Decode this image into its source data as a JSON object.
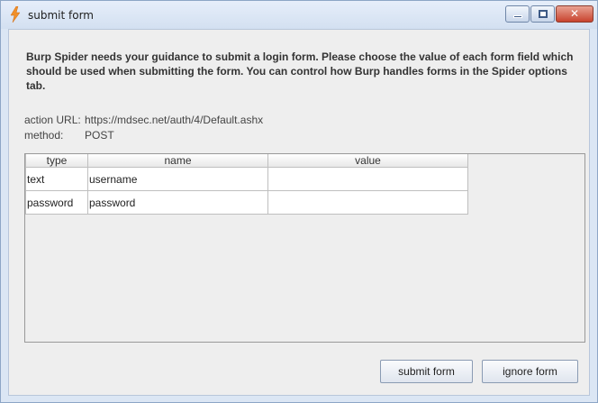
{
  "window": {
    "title": "submit form",
    "close_glyph": "✕"
  },
  "instructions": "Burp Spider needs your guidance to submit a login form. Please choose the value of each form field which should be used when submitting the form. You can control how Burp handles forms in the Spider options tab.",
  "form_info": {
    "action_label": "action URL:",
    "action_value": "https://mdsec.net/auth/4/Default.ashx",
    "method_label": "method:",
    "method_value": "POST"
  },
  "table": {
    "headers": [
      "type",
      "name",
      "value"
    ],
    "rows": [
      {
        "type": "text",
        "name": "username",
        "value": ""
      },
      {
        "type": "password",
        "name": "password",
        "value": ""
      }
    ]
  },
  "buttons": {
    "submit": "submit form",
    "ignore": "ignore form"
  }
}
